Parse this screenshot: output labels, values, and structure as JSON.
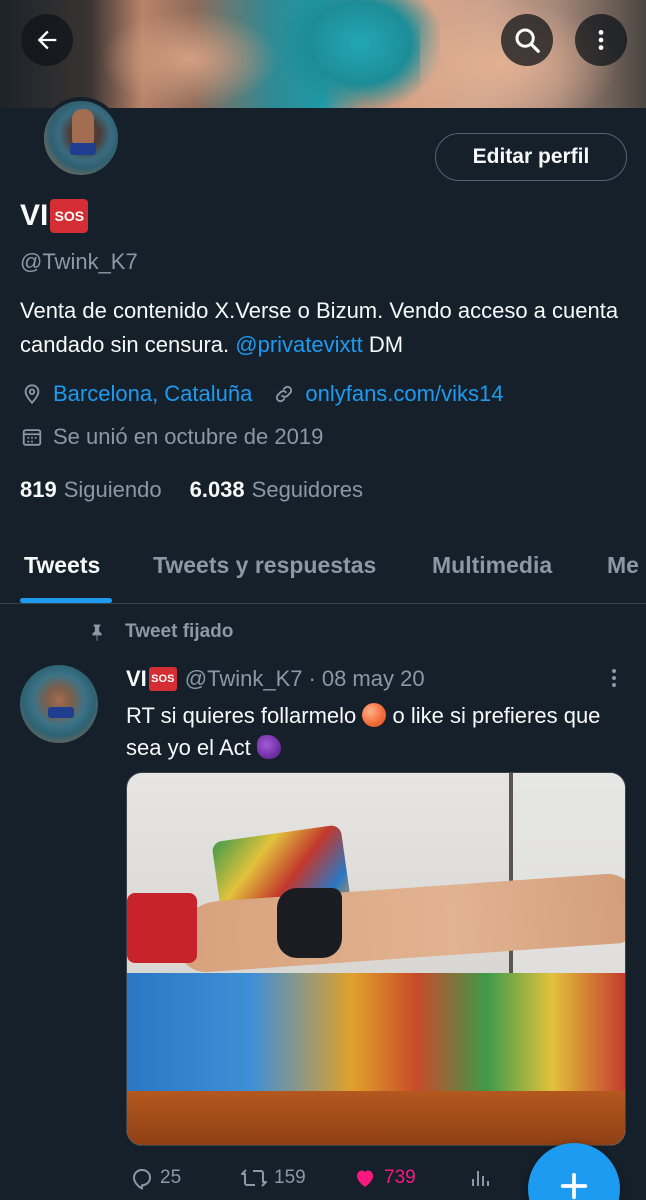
{
  "header": {
    "back_icon": "arrow-left-icon",
    "search_icon": "search-icon",
    "more_icon": "more-vertical-icon"
  },
  "profile": {
    "edit_button": "Editar perfil",
    "display_name": "VI",
    "name_badge": "SOS",
    "handle": "@Twink_K7",
    "bio_text": "Venta de contenido X.Verse o Bizum. Vendo acceso a cuenta candado sin censura.",
    "bio_mention": "@privatevixtt",
    "bio_suffix": "DM",
    "location": "Barcelona, Cataluña",
    "website": "onlyfans.com/viks14",
    "joined": "Se unió en octubre de 2019",
    "following_count": "819",
    "following_label": "Siguiendo",
    "followers_count": "6.038",
    "followers_label": "Seguidores"
  },
  "tabs": [
    {
      "label": "Tweets",
      "active": true
    },
    {
      "label": "Tweets y respuestas",
      "active": false
    },
    {
      "label": "Multimedia",
      "active": false
    },
    {
      "label": "Me",
      "active": false
    }
  ],
  "tweet": {
    "pinned_label": "Tweet fijado",
    "author_name": "VI",
    "author_badge": "SOS",
    "author_handle": "@Twink_K7",
    "separator": "·",
    "date": "08 may 20",
    "text_part1": "RT si quieres follarmelo",
    "text_part2": "o like si prefieres que sea yo el Act",
    "replies": "25",
    "retweets": "159",
    "likes": "739"
  },
  "colors": {
    "background": "#15202b",
    "accent": "#1d9bf0",
    "like": "#f91880",
    "muted": "#8b98a5"
  }
}
